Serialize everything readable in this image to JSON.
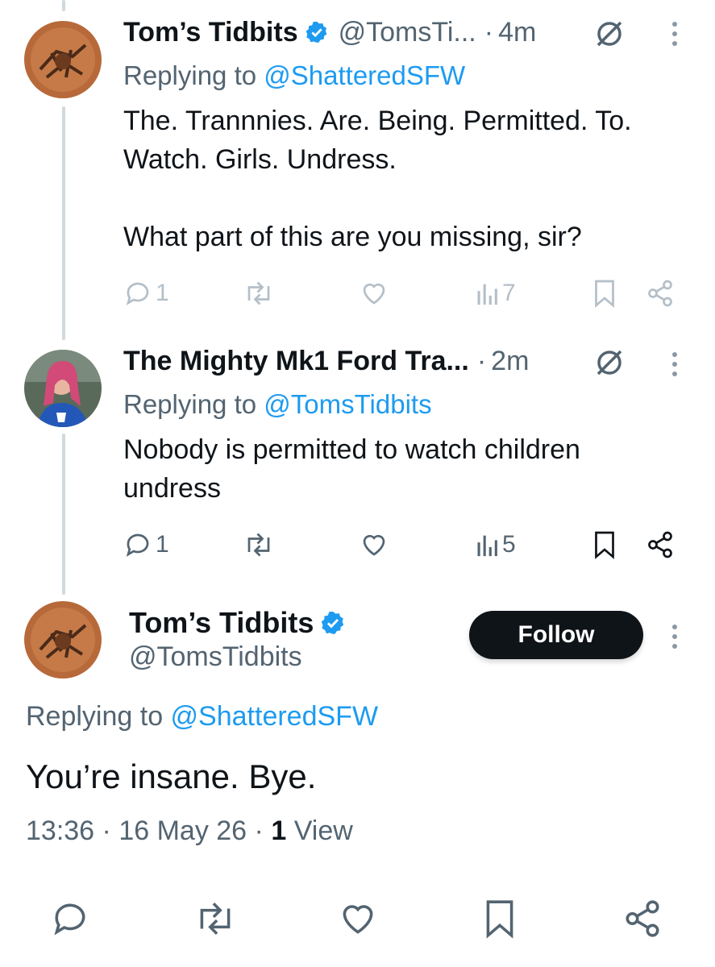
{
  "tweets": [
    {
      "name": "Tom’s Tidbits",
      "handle": "@TomsTi...",
      "dot": "·",
      "time": "4m",
      "reply_label": "Replying to ",
      "reply_handle": "@ShatteredSFW",
      "text": "The. Trannnies. Are. Being. Permitted. To. Watch. Girls. Undress.\n\nWhat part of this are you missing, sir?",
      "stats": {
        "replies": "1",
        "retweets": "",
        "likes": "",
        "views": "7"
      }
    },
    {
      "name": "The Mighty Mk1 Ford Tra...",
      "dot": "·",
      "time": "2m",
      "reply_label": "Replying to ",
      "reply_handle": "@TomsTidbits",
      "text": "Nobody is permitted to watch children undress",
      "stats": {
        "replies": "1",
        "retweets": "",
        "likes": "",
        "views": "5"
      }
    }
  ],
  "main": {
    "name": "Tom’s Tidbits",
    "handle": "@TomsTidbits",
    "follow_label": "Follow",
    "reply_label": "Replying to ",
    "reply_handle": "@ShatteredSFW",
    "text": "You’re insane. Bye.",
    "time": "13:36",
    "sep": "·",
    "date": "16 May 26",
    "views_count": "1",
    "views_label": "View"
  },
  "icons": {
    "reply": "reply-icon",
    "retweet": "retweet-icon",
    "like": "heart-icon",
    "views": "views-icon",
    "bookmark": "bookmark-icon",
    "share": "share-icon",
    "grok": "grok-icon",
    "more": "more-icon",
    "verified": "verified-badge-icon"
  },
  "colors": {
    "accent": "#1d9bf0",
    "text": "#0f1419",
    "muted": "#536471",
    "line": "#cfd9de"
  }
}
